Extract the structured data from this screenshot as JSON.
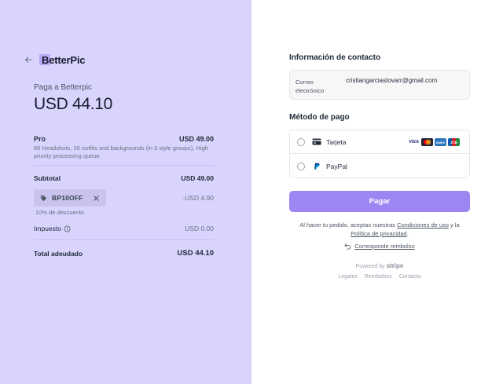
{
  "summary": {
    "brand_name": "BetterPic",
    "pay_label": "Paga a Betterpic",
    "pay_amount": "USD 44.10",
    "item": {
      "name": "Pro",
      "price": "USD 49.00",
      "description": "60 Headshots, 20 outfits and backgrounds (in 3 style groups), High priority processing queue"
    },
    "subtotal_label": "Subtotal",
    "subtotal_value": "USD 49.00",
    "promo_code": "BP10OFF",
    "discount_value": "-USD 4.90",
    "discount_note": "10% de descuento",
    "tax_label": "Impuesto",
    "tax_value": "USD 0.00",
    "total_label": "Total adeudado",
    "total_value": "USD 44.10"
  },
  "checkout": {
    "contact_title": "Información de contacto",
    "email_label": "Correo electrónico",
    "email_value": "cristiangarciastovarr@gmail.com",
    "payment_title": "Método de pago",
    "methods": [
      {
        "label": "Tarjeta",
        "icon": "card-icon"
      },
      {
        "label": "PayPal",
        "icon": "paypal-icon"
      }
    ],
    "card_brands": [
      "VISA",
      "MC",
      "AMEX",
      "JCB"
    ],
    "pay_button": "Pagar",
    "legal_prefix": "Al hacer tu pedido, aceptas nuestras ",
    "terms_link": "Condiciones de uso",
    "legal_and": " y la ",
    "privacy_link": "Política de privacidad",
    "legal_suffix": ".",
    "refund_link": "Corresponde rembolso",
    "powered_prefix": "Powered by ",
    "powered_brand": "stripe",
    "footer": [
      "Legales",
      "Rembolsos",
      "Contacto"
    ]
  },
  "colors": {
    "left_bg": "#d9d4fe",
    "accent": "#9d86f2"
  }
}
